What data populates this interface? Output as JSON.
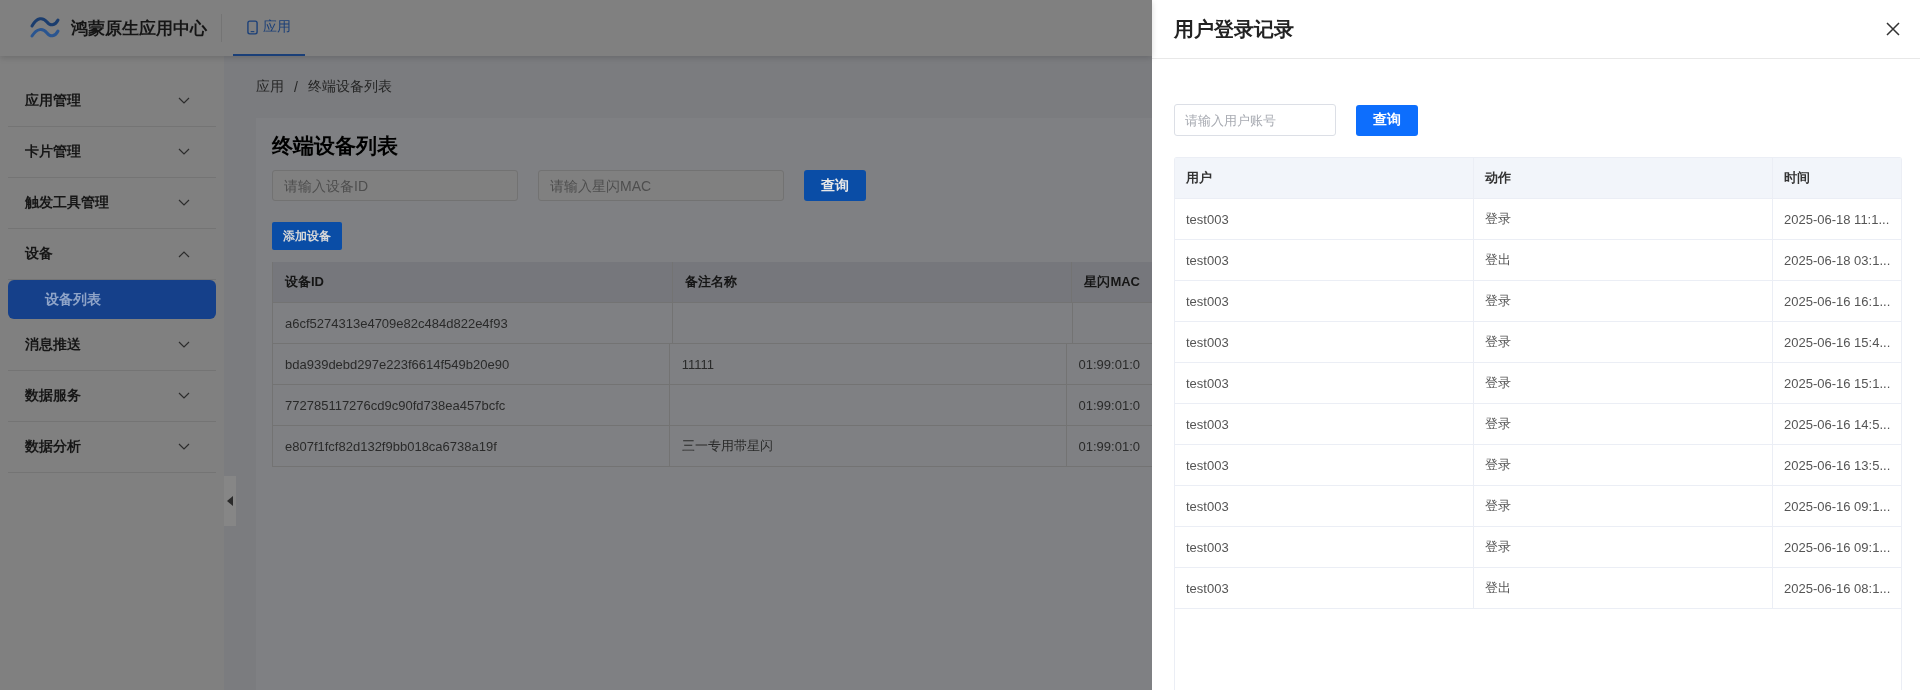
{
  "header": {
    "title": "鸿蒙原生应用中心",
    "nav": [
      {
        "label": "应用",
        "selected": true
      }
    ]
  },
  "sidebar": {
    "items": [
      {
        "label": "应用管理",
        "expanded": false
      },
      {
        "label": "卡片管理",
        "expanded": false
      },
      {
        "label": "触发工具管理",
        "expanded": false
      },
      {
        "label": "设备",
        "expanded": true,
        "children": [
          {
            "label": "设备列表",
            "selected": true
          }
        ]
      },
      {
        "label": "消息推送",
        "expanded": false
      },
      {
        "label": "数据服务",
        "expanded": false
      },
      {
        "label": "数据分析",
        "expanded": false
      }
    ]
  },
  "breadcrumb": {
    "items": [
      "应用",
      "终端设备列表"
    ],
    "separator": "/"
  },
  "page": {
    "title": "终端设备列表",
    "filters": [
      {
        "placeholder": "请输入设备ID"
      },
      {
        "placeholder": "请输入星闪MAC"
      }
    ],
    "query_button": "查询",
    "add_button": "添加设备",
    "table": {
      "columns": [
        "设备ID",
        "备注名称",
        "星闪MAC"
      ],
      "rows": [
        {
          "device_id": "a6cf5274313e4709e82c484d822e4f93"
        },
        {
          "device_id": "bda939debd297e223f6614f549b20e90",
          "remark": "11111",
          "mac": "01:99:01:0"
        },
        {
          "device_id": "772785117276cd9c90fd738ea457bcfc",
          "mac": "01:99:01:0"
        },
        {
          "device_id": "e807f1fcf82d132f9bb018ca6738a19f",
          "remark": "三一专用带星闪",
          "mac": "01:99:01:0"
        }
      ]
    }
  },
  "drawer": {
    "title": "用户登录记录",
    "search": {
      "placeholder": "请输入用户账号"
    },
    "query_button": "查询",
    "table": {
      "columns": [
        "用户",
        "动作",
        "时间"
      ],
      "rows": [
        {
          "user": "test003",
          "action": "登录",
          "time": "2025-06-18 11:1..."
        },
        {
          "user": "test003",
          "action": "登出",
          "time": "2025-06-18 03:1..."
        },
        {
          "user": "test003",
          "action": "登录",
          "time": "2025-06-16 16:1..."
        },
        {
          "user": "test003",
          "action": "登录",
          "time": "2025-06-16 15:4..."
        },
        {
          "user": "test003",
          "action": "登录",
          "time": "2025-06-16 15:1..."
        },
        {
          "user": "test003",
          "action": "登录",
          "time": "2025-06-16 14:5..."
        },
        {
          "user": "test003",
          "action": "登录",
          "time": "2025-06-16 13:5..."
        },
        {
          "user": "test003",
          "action": "登录",
          "time": "2025-06-16 09:1..."
        },
        {
          "user": "test003",
          "action": "登录",
          "time": "2025-06-16 09:1..."
        },
        {
          "user": "test003",
          "action": "登出",
          "time": "2025-06-16 08:1..."
        }
      ]
    }
  }
}
